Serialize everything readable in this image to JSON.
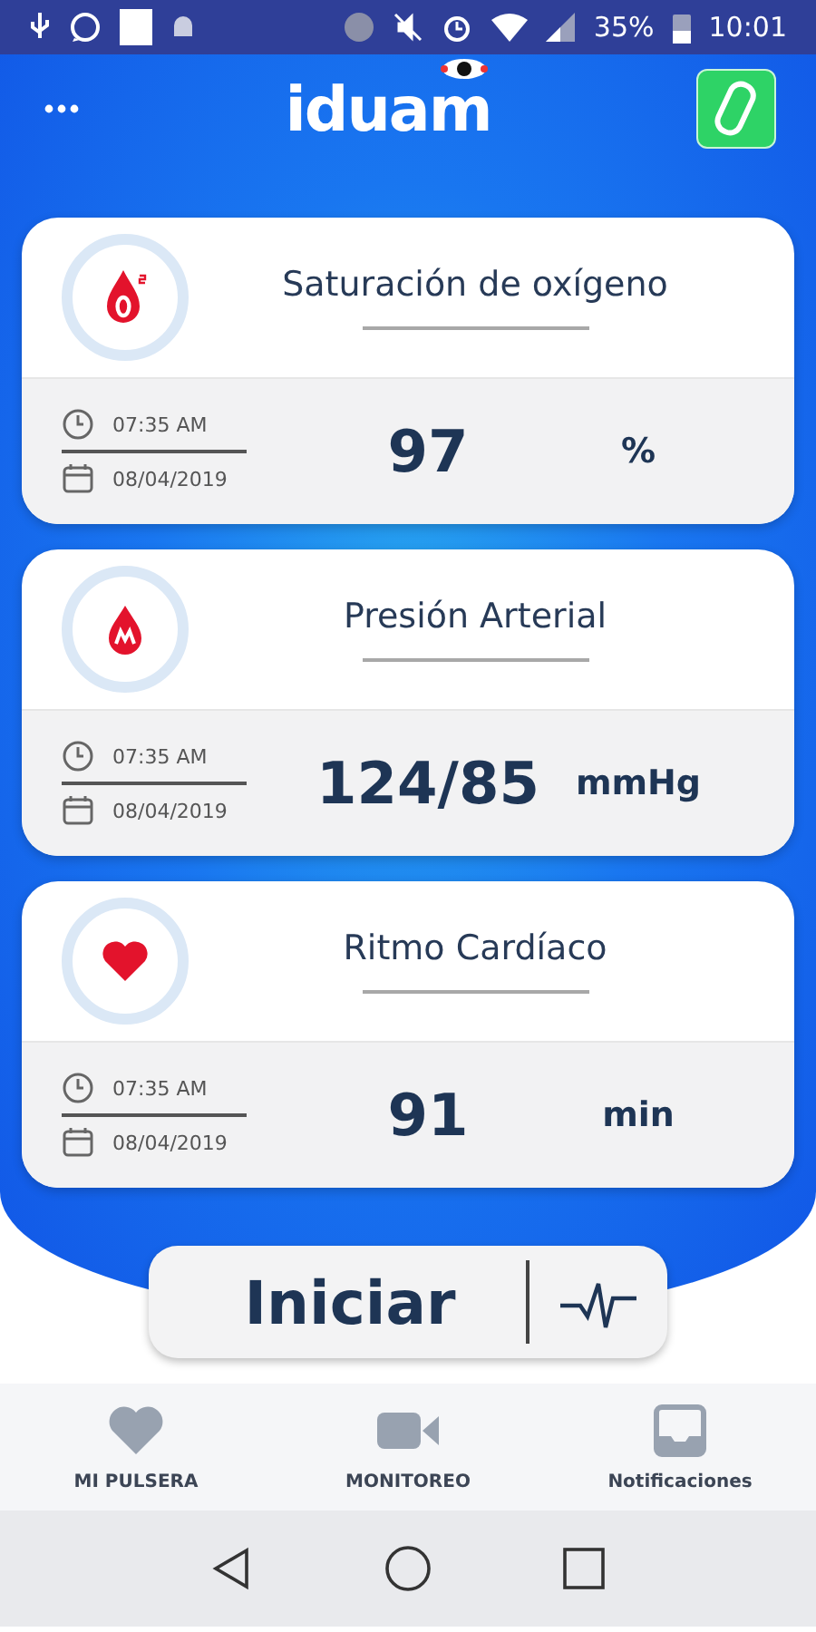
{
  "status_bar": {
    "battery": "35%",
    "time": "10:01"
  },
  "header": {
    "logo": "iduam"
  },
  "cards": [
    {
      "kind": "oxygen",
      "title": "Saturación de oxígeno",
      "time": "07:35 AM",
      "date": "08/04/2019",
      "value": "97",
      "unit": "%"
    },
    {
      "kind": "pressure",
      "title": "Presión Arterial",
      "time": "07:35 AM",
      "date": "08/04/2019",
      "value": "124/85",
      "unit": "mmHg"
    },
    {
      "kind": "heart",
      "title": "Ritmo Cardíaco",
      "time": "07:35 AM",
      "date": "08/04/2019",
      "value": "91",
      "unit": "min"
    }
  ],
  "start_button": {
    "label": "Iniciar"
  },
  "bottom_nav": [
    {
      "kind": "heart",
      "label": "MI PULSERA"
    },
    {
      "kind": "video",
      "label": "MONITOREO"
    },
    {
      "kind": "inbox",
      "label": "Notificaciones"
    }
  ]
}
